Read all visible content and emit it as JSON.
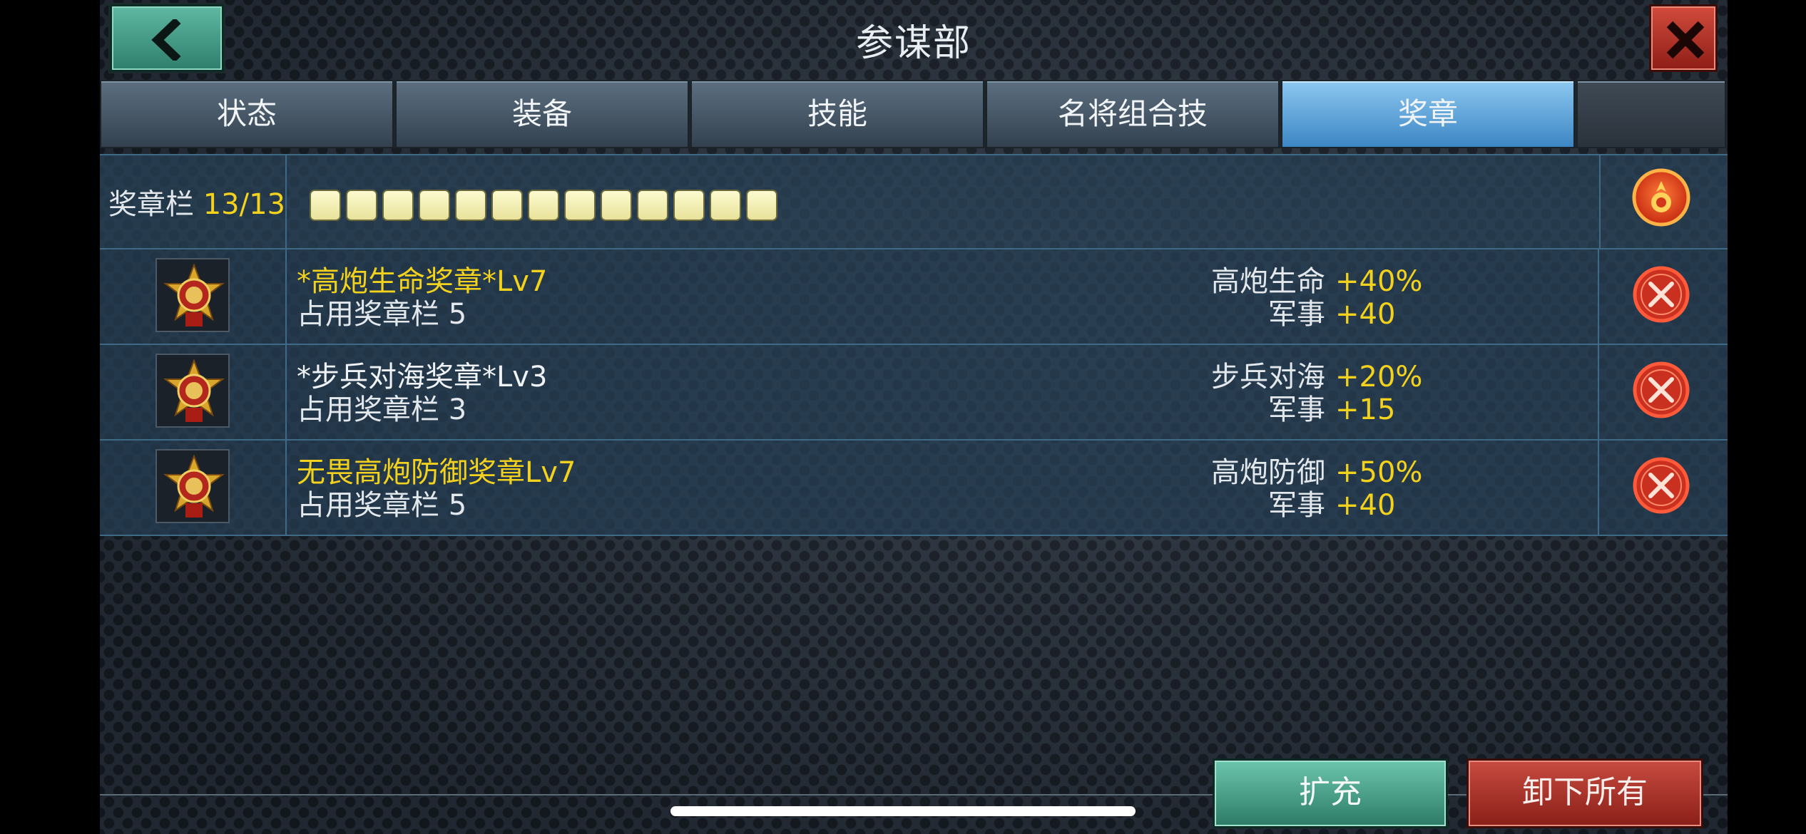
{
  "header": {
    "title": "参谋部",
    "back_icon": "chevron-left-icon",
    "close_icon": "close-x-icon"
  },
  "tabs": [
    {
      "label": "状态",
      "active": false
    },
    {
      "label": "装备",
      "active": false
    },
    {
      "label": "技能",
      "active": false
    },
    {
      "label": "名将组合技",
      "active": false
    },
    {
      "label": "奖章",
      "active": true
    }
  ],
  "slot_bar": {
    "label": "奖章栏",
    "count": "13/13",
    "filled": 13,
    "total": 13
  },
  "medals": [
    {
      "name": "*高炮生命奖章*Lv7",
      "name_color": "#f3d21e",
      "slots_text": "占用奖章栏 5",
      "stat1_label": "高炮生命",
      "stat1_value": "+40%",
      "stat2_label": "军事",
      "stat2_value": "+40"
    },
    {
      "name": "*步兵对海奖章*Lv3",
      "name_color": "#f0f3f5",
      "slots_text": "占用奖章栏 3",
      "stat1_label": "步兵对海",
      "stat1_value": "+20%",
      "stat2_label": "军事",
      "stat2_value": "+15"
    },
    {
      "name": "无畏高炮防御奖章Lv7",
      "name_color": "#f3d21e",
      "slots_text": "占用奖章栏 5",
      "stat1_label": "高炮防御",
      "stat1_value": "+50%",
      "stat2_label": "军事",
      "stat2_value": "+40"
    }
  ],
  "buttons": {
    "expand": "扩充",
    "unload_all": "卸下所有"
  },
  "colors": {
    "accent_yellow": "#f3d21e",
    "active_tab": "#5aa6e0",
    "danger": "#e83a2a"
  }
}
